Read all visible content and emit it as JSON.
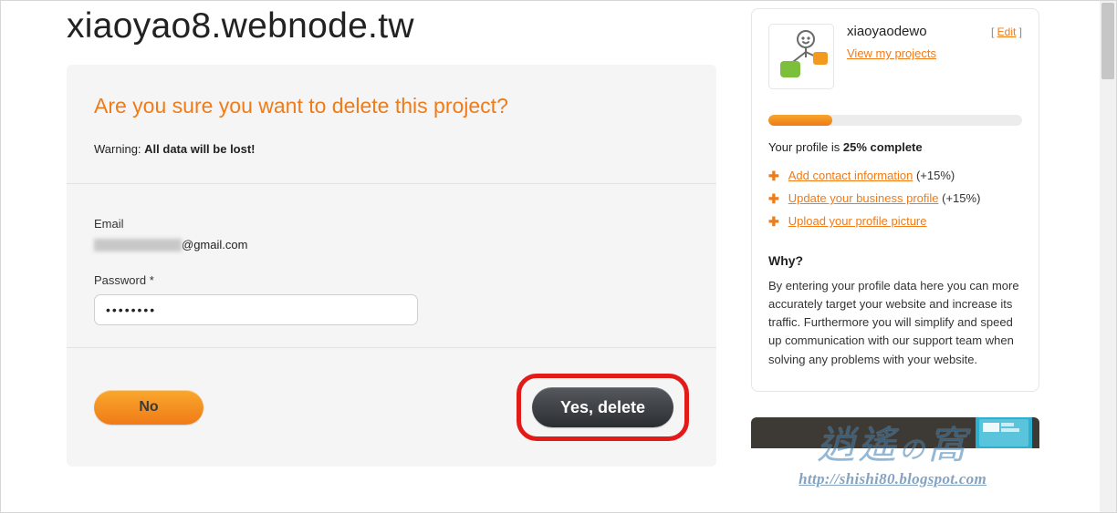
{
  "page_title": "xiaoyao8.webnode.tw",
  "panel": {
    "heading": "Are you sure you want to delete this project?",
    "warning_prefix": "Warning: ",
    "warning_bold": "All data will be lost!",
    "email_label": "Email",
    "email_suffix": "@gmail.com",
    "password_label": "Password *",
    "password_value": "••••••••",
    "no_label": "No",
    "yes_label": "Yes, delete"
  },
  "sidebar": {
    "username": "xiaoyaodewo",
    "edit_prefix": "[ ",
    "edit_label": "Edit",
    "edit_suffix": " ]",
    "projects_link": "View my projects",
    "progress_percent": 25,
    "progress_text_prefix": "Your profile is ",
    "progress_text_bold": "25% complete",
    "suggestions": [
      {
        "label": "Add contact information",
        "gain": "(+15%)"
      },
      {
        "label": "Update your business profile",
        "gain": "(+15%)"
      },
      {
        "label": "Upload your profile picture",
        "gain": ""
      }
    ],
    "why_heading": "Why?",
    "why_text": "By entering your profile data here you can more accurately target your website and increase its traffic. Furthermore you will simplify and speed up communication with our support team when solving any problems with your website."
  },
  "watermark": {
    "title": "逍遙の窩",
    "url": "http://shishi80.blogspot.com"
  },
  "colors": {
    "accent": "#f07b19"
  }
}
